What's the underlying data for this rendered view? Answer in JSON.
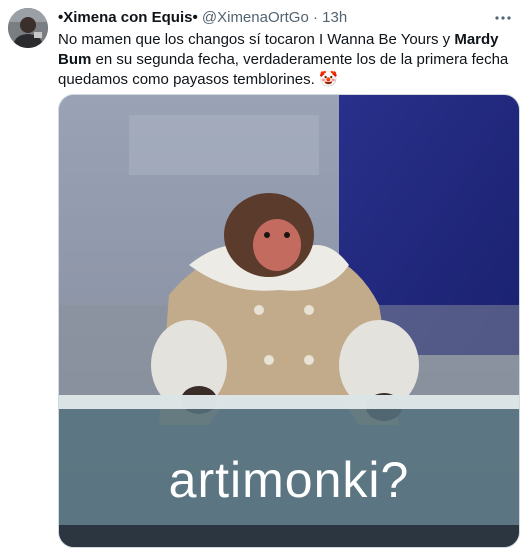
{
  "tweet": {
    "author_name": "•Ximena con Equis•",
    "handle": "@XimenaOrtGo",
    "separator": "·",
    "time": "13h",
    "text_part1": "No mamen que los changos sí tocaron I Wanna Be Yours y ",
    "text_bold": "Mardy Bum",
    "text_part2": " en su segunda fecha, verdaderamente los de la primera fecha quedamos como payasos temblorines. ",
    "emoji": "🤡",
    "more_icon": "more-horizontal-icon"
  },
  "media": {
    "caption": "artimonki?",
    "subject": "monkey in shearling coat"
  }
}
